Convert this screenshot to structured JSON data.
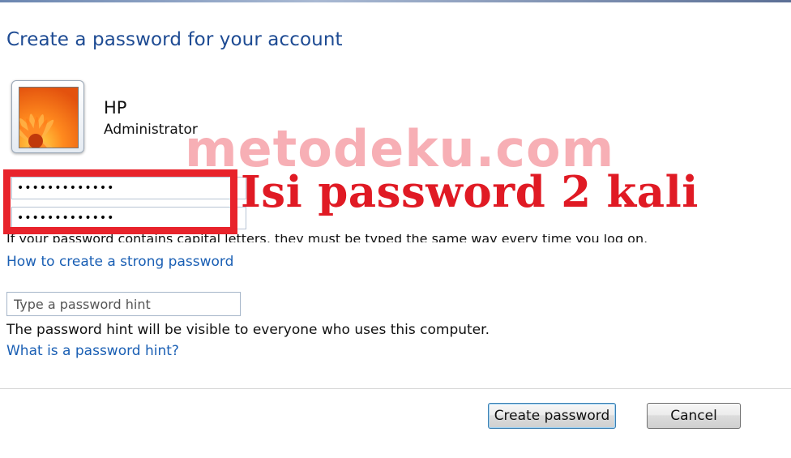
{
  "dialog": {
    "title": "Create a password for your account"
  },
  "user": {
    "name": "HP",
    "role": "Administrator"
  },
  "password_fields": {
    "new_password_value": "•••••••••••••",
    "confirm_password_value": "•••••••••••••"
  },
  "annotation": {
    "watermark": "metodeku.com",
    "instruction": "Isi password 2 kali"
  },
  "capital_letters_note": "If your password contains capital letters, they must be typed the same way every time you log on.",
  "links": {
    "strong_password": "How to create a strong password",
    "password_hint_help": "What is a password hint?"
  },
  "hint": {
    "placeholder": "Type a password hint",
    "note": "The password hint will be visible to everyone who uses this computer."
  },
  "buttons": {
    "create": "Create password",
    "cancel": "Cancel"
  },
  "colors": {
    "title_blue": "#1e4b93",
    "link_blue": "#1a5fb4",
    "annotation_red": "#e01a24",
    "watermark_pink": "#f06e78"
  },
  "icons": {
    "avatar": "orange-flower-avatar"
  }
}
